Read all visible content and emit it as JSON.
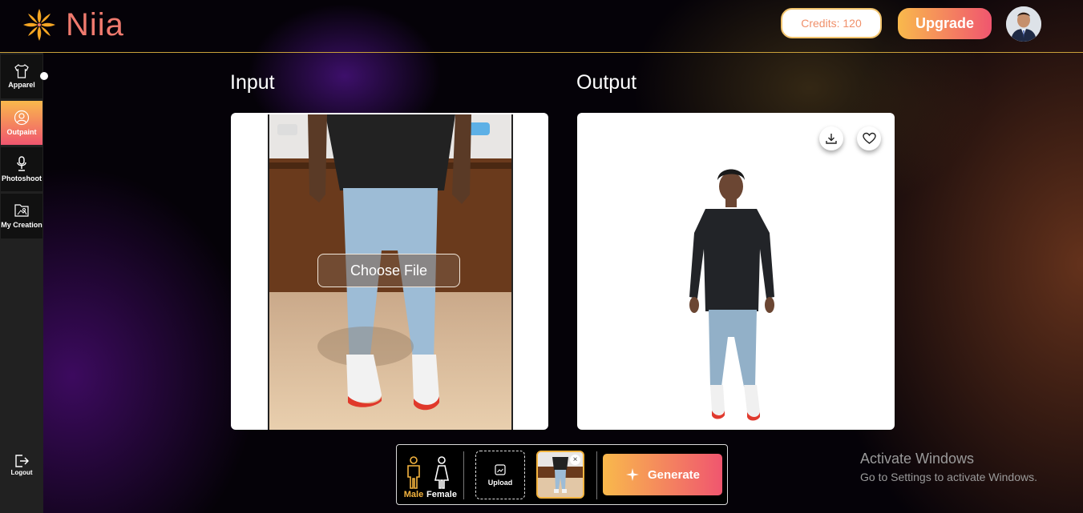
{
  "header": {
    "logo_text": "Niia",
    "credits_label": "Credits: 120",
    "upgrade_label": "Upgrade"
  },
  "sidebar": {
    "items": [
      {
        "label": "Apparel",
        "icon": "shirt-icon",
        "active": false
      },
      {
        "label": "Outpaint",
        "icon": "user-circle-icon",
        "active": true
      },
      {
        "label": "Photoshoot",
        "icon": "mic-person-icon",
        "active": false
      },
      {
        "label": "My Creation",
        "icon": "folder-image-icon",
        "active": false
      }
    ],
    "logout_label": "Logout"
  },
  "input": {
    "title": "Input",
    "choose_file_label": "Choose File"
  },
  "output": {
    "title": "Output"
  },
  "bottom_bar": {
    "male_label": "Male",
    "female_label": "Female",
    "upload_label": "Upload",
    "generate_label": "Generate",
    "selected_gender": "Male"
  },
  "watermark": {
    "line1": "Activate Windows",
    "line2": "Go to Settings to activate Windows."
  },
  "colors": {
    "accent_start": "#f9b94c",
    "accent_end": "#f0566f",
    "logo": "#f07a6e",
    "selected_gender": "#f4b43f"
  }
}
